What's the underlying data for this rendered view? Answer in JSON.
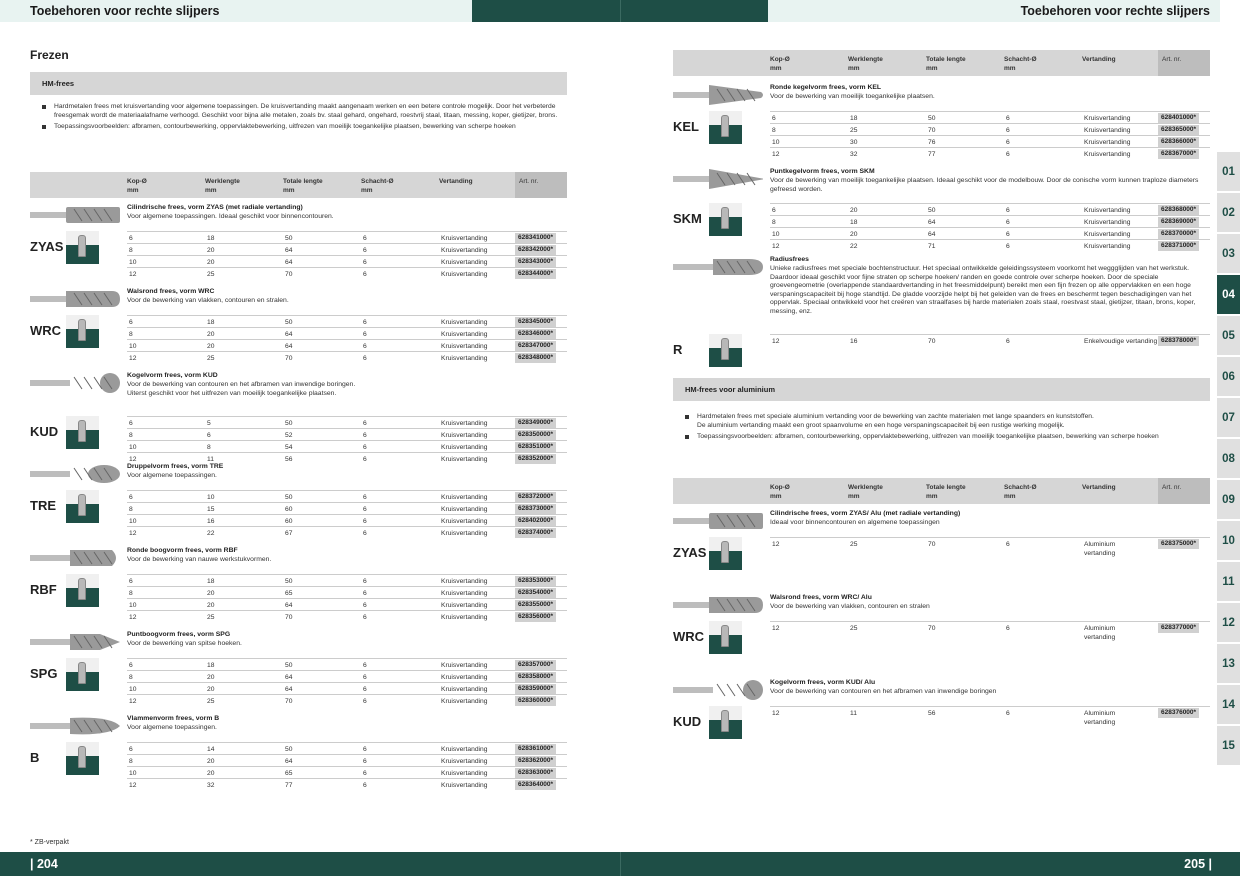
{
  "header": {
    "left": "Toebehoren voor rechte slijpers",
    "right": "Toebehoren voor rechte slijpers"
  },
  "footer": {
    "left_page": "| 204",
    "right_page": "205 |",
    "note": "* ZB-verpakt"
  },
  "left": {
    "section": "Frezen",
    "group": "HM-frees",
    "bullets": [
      "Hardmetalen frees met kruisvertanding voor algemene toepassingen. De kruisvertanding maakt aangenaam werken en een betere controle mogelijk. Door het verbeterde freesgemak wordt de materiaalafname verhoogd. Geschikt voor bijna alle metalen, zoals bv. staal gehard, ongehard, roestvrij staal, titaan, messing, koper, gietijzer, brons.",
      "Toepassingsvoorbeelden: afbramen, contourbewerking, oppervlaktebewerking, uitfrezen van moeilijk toegankelijke plaatsen, bewerking van scherpe hoeken"
    ],
    "columns": [
      "Kop-Ø\nmm",
      "Werklengte\nmm",
      "Totale lengte\nmm",
      "Schacht-Ø\nmm",
      "Vertanding",
      "Art. nr."
    ],
    "products": [
      {
        "code": "ZYAS",
        "name": "Cilindrische frees, vorm ZYAS (met radiale vertanding)",
        "desc": "Voor algemene toepassingen. Ideaal geschikt voor binnencontouren.",
        "rows": [
          [
            "6",
            "18",
            "50",
            "6",
            "Kruisvertanding",
            "628341000*"
          ],
          [
            "8",
            "20",
            "64",
            "6",
            "Kruisvertanding",
            "628342000*"
          ],
          [
            "10",
            "20",
            "64",
            "6",
            "Kruisvertanding",
            "628343000*"
          ],
          [
            "12",
            "25",
            "70",
            "6",
            "Kruisvertanding",
            "628344000*"
          ]
        ]
      },
      {
        "code": "WRC",
        "name": "Walsrond frees, vorm WRC",
        "desc": "Voor de bewerking van vlakken, contouren en stralen.",
        "rows": [
          [
            "6",
            "18",
            "50",
            "6",
            "Kruisvertanding",
            "628345000*"
          ],
          [
            "8",
            "20",
            "64",
            "6",
            "Kruisvertanding",
            "628346000*"
          ],
          [
            "10",
            "20",
            "64",
            "6",
            "Kruisvertanding",
            "628347000*"
          ],
          [
            "12",
            "25",
            "70",
            "6",
            "Kruisvertanding",
            "628348000*"
          ]
        ]
      },
      {
        "code": "KUD",
        "name": "Kogelvorm frees, vorm KUD",
        "desc": "Voor de bewerking van contouren en het afbramen van inwendige boringen.\nUiterst geschikt voor het uitfrezen van moeilijk toegankelijke plaatsen.",
        "rows": [
          [
            "6",
            "5",
            "50",
            "6",
            "Kruisvertanding",
            "628349000*"
          ],
          [
            "8",
            "6",
            "52",
            "6",
            "Kruisvertanding",
            "628350000*"
          ],
          [
            "10",
            "8",
            "54",
            "6",
            "Kruisvertanding",
            "628351000*"
          ],
          [
            "12",
            "11",
            "56",
            "6",
            "Kruisvertanding",
            "628352000*"
          ]
        ]
      },
      {
        "code": "TRE",
        "name": "Druppelvorm frees, vorm TRE",
        "desc": "Voor algemene toepassingen.",
        "rows": [
          [
            "6",
            "10",
            "50",
            "6",
            "Kruisvertanding",
            "628372000*"
          ],
          [
            "8",
            "15",
            "60",
            "6",
            "Kruisvertanding",
            "628373000*"
          ],
          [
            "10",
            "16",
            "60",
            "6",
            "Kruisvertanding",
            "628402000*"
          ],
          [
            "12",
            "22",
            "67",
            "6",
            "Kruisvertanding",
            "628374000*"
          ]
        ]
      },
      {
        "code": "RBF",
        "name": "Ronde boogvorm frees, vorm RBF",
        "desc": "Voor de bewerking van nauwe werkstukvormen.",
        "rows": [
          [
            "6",
            "18",
            "50",
            "6",
            "Kruisvertanding",
            "628353000*"
          ],
          [
            "8",
            "20",
            "65",
            "6",
            "Kruisvertanding",
            "628354000*"
          ],
          [
            "10",
            "20",
            "64",
            "6",
            "Kruisvertanding",
            "628355000*"
          ],
          [
            "12",
            "25",
            "70",
            "6",
            "Kruisvertanding",
            "628356000*"
          ]
        ]
      },
      {
        "code": "SPG",
        "name": "Puntboogvorm frees, vorm SPG",
        "desc": "Voor de bewerking van spitse hoeken.",
        "rows": [
          [
            "6",
            "18",
            "50",
            "6",
            "Kruisvertanding",
            "628357000*"
          ],
          [
            "8",
            "20",
            "64",
            "6",
            "Kruisvertanding",
            "628358000*"
          ],
          [
            "10",
            "20",
            "64",
            "6",
            "Kruisvertanding",
            "628359000*"
          ],
          [
            "12",
            "25",
            "70",
            "6",
            "Kruisvertanding",
            "628360000*"
          ]
        ]
      },
      {
        "code": "B",
        "name": "Vlammenvorm frees, vorm B",
        "desc": "Voor algemene toepassingen.",
        "rows": [
          [
            "6",
            "14",
            "50",
            "6",
            "Kruisvertanding",
            "628361000*"
          ],
          [
            "8",
            "20",
            "64",
            "6",
            "Kruisvertanding",
            "628362000*"
          ],
          [
            "10",
            "20",
            "65",
            "6",
            "Kruisvertanding",
            "628363000*"
          ],
          [
            "12",
            "32",
            "77",
            "6",
            "Kruisvertanding",
            "628364000*"
          ]
        ]
      }
    ]
  },
  "right": {
    "columns": [
      "Kop-Ø\nmm",
      "Werklengte\nmm",
      "Totale lengte\nmm",
      "Schacht-Ø\nmm",
      "Vertanding",
      "Art. nr."
    ],
    "products": [
      {
        "code": "KEL",
        "name": "Ronde kegelvorm frees, vorm KEL",
        "desc": "Voor de bewerking van moeilijk toegankelijke plaatsen.",
        "rows": [
          [
            "6",
            "18",
            "50",
            "6",
            "Kruisvertanding",
            "628401000*"
          ],
          [
            "8",
            "25",
            "70",
            "6",
            "Kruisvertanding",
            "628365000*"
          ],
          [
            "10",
            "30",
            "76",
            "6",
            "Kruisvertanding",
            "628366000*"
          ],
          [
            "12",
            "32",
            "77",
            "6",
            "Kruisvertanding",
            "628367000*"
          ]
        ]
      },
      {
        "code": "SKM",
        "name": "Puntkegelvorm frees, vorm SKM",
        "desc": "Voor de bewerking van moeilijk toegankelijke plaatsen. Ideaal geschikt voor de modelbouw. Door de conische vorm kunnen traploze diameters gefreesd worden.",
        "rows": [
          [
            "6",
            "20",
            "50",
            "6",
            "Kruisvertanding",
            "628368000*"
          ],
          [
            "8",
            "18",
            "64",
            "6",
            "Kruisvertanding",
            "628369000*"
          ],
          [
            "10",
            "20",
            "64",
            "6",
            "Kruisvertanding",
            "628370000*"
          ],
          [
            "12",
            "22",
            "71",
            "6",
            "Kruisvertanding",
            "628371000*"
          ]
        ]
      },
      {
        "code": "R",
        "name": "Radiusfrees",
        "desc": "Unieke radiusfrees met speciale bochtenstructuur. Het speciaal ontwikkelde geleidingssysteem voorkomt het weggglijden van het werkstuk. Daardoor ideaal geschikt voor fijne straten op scherpe hoeken/ randen en goede controle over scherpe hoeken. Door de speciale groevengeometrie (overlappende standaardvertanding in het freesmiddelpunt) bereikt men een fijn frezen op alle oppervlakken en een hoge verspaningscapaciteit bij hoge standtijd. De gladde voorzijde helpt bij het geleiden van de frees en beschermt tegen beschadigingen van het oppervlak. Speciaal ontwikkeld voor het creëren van straalfases bij harde materialen zoals staal, roestvast staal, gietijzer, titaan, brons, koper, messing, enz.",
        "rows": [
          [
            "12",
            "16",
            "70",
            "6",
            "Enkelvoudige vertanding",
            "628378000*"
          ]
        ]
      }
    ],
    "group2": "HM-frees voor aluminium",
    "bullets2": [
      "Hardmetalen frees met speciale aluminium vertanding voor de bewerking van zachte materialen met lange spaanders en kunststoffen.\nDe aluminium vertanding maakt een groot spaanvolume en een hoge verspaningscapaciteit bij een rustige werking mogelijk.",
      "Toepassingsvoorbeelden: afbramen, contourbewerking, oppervlaktebewerking, uitfrezen van moeilijk toegankelijke plaatsen, bewerking van scherpe hoeken"
    ],
    "alu_products": [
      {
        "code": "ZYAS",
        "name": "Cilindrische frees, vorm ZYAS/ Alu (met radiale vertanding)",
        "desc": "Ideaal voor binnencontouren en algemene toepassingen",
        "rows": [
          [
            "12",
            "25",
            "70",
            "6",
            "Aluminium\nvertanding",
            "628375000*"
          ]
        ]
      },
      {
        "code": "WRC",
        "name": "Walsrond frees, vorm WRC/ Alu",
        "desc": "Voor de bewerking van vlakken, contouren en stralen",
        "rows": [
          [
            "12",
            "25",
            "70",
            "6",
            "Aluminium\nvertanding",
            "628377000*"
          ]
        ]
      },
      {
        "code": "KUD",
        "name": "Kogelvorm frees, vorm KUD/ Alu",
        "desc": "Voor de bewerking van contouren en het afbramen van inwendige boringen",
        "rows": [
          [
            "12",
            "11",
            "56",
            "6",
            "Aluminium\nvertanding",
            "628376000*"
          ]
        ]
      }
    ]
  },
  "tabs": [
    "01",
    "02",
    "03",
    "04",
    "05",
    "06",
    "07",
    "08",
    "09",
    "10",
    "11",
    "12",
    "13",
    "14",
    "15"
  ],
  "active_tab": "04",
  "colors": {
    "dark_green": "#1e4e46",
    "header_bg": "#e8f3f1",
    "bar_grey": "#d6d6d6"
  }
}
